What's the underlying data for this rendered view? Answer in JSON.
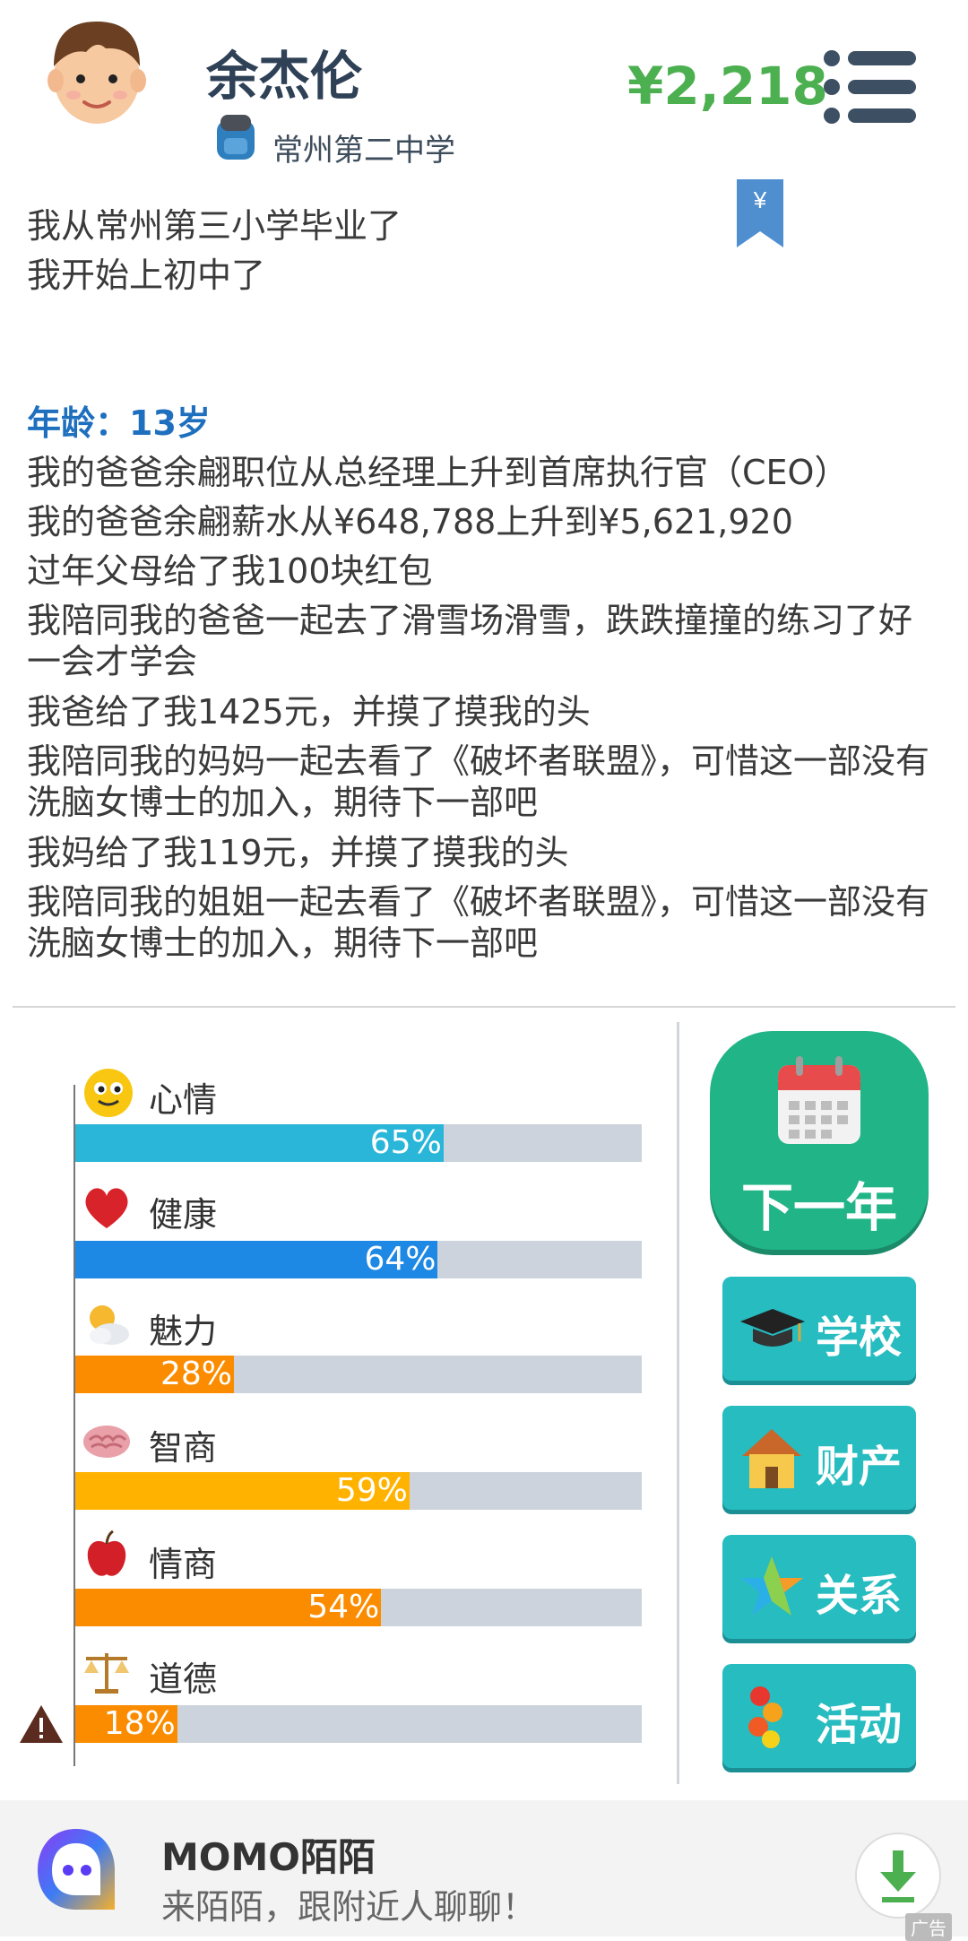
{
  "header": {
    "name": "余杰伦",
    "school": "常州第二中学",
    "money": "¥2,218",
    "avatar_icon": "boy-avatar-icon",
    "school_icon": "backpack-icon",
    "menu_icon": "menu-icon"
  },
  "log": {
    "lines_before": [
      "我从常州第三小学毕业了",
      "我开始上初中了"
    ],
    "age_label": "年龄：13岁",
    "lines_after": [
      "我的爸爸余翩职位从总经理上升到首席执行官（CEO）",
      "我的爸爸余翩薪水从¥648,788上升到¥5,621,920",
      "过年父母给了我100块红包",
      "我陪同我的爸爸一起去了滑雪场滑雪，跌跌撞撞的练习了好一会才学会",
      "我爸给了我1425元，并摸了摸我的头",
      "我陪同我的妈妈一起去看了《破坏者联盟》，可惜这一部没有洗脑女博士的加入，期待下一部吧",
      "我妈给了我119元，并摸了摸我的头",
      "我陪同我的姐姐一起去看了《破坏者联盟》，可惜这一部没有洗脑女博士的加入，期待下一部吧"
    ]
  },
  "stats": [
    {
      "label": "心情",
      "value": 65,
      "text": "65%",
      "color": "#29b6d8",
      "icon": "smiley-icon"
    },
    {
      "label": "健康",
      "value": 64,
      "text": "64%",
      "color": "#1e88e5",
      "icon": "heart-icon"
    },
    {
      "label": "魅力",
      "value": 28,
      "text": "28%",
      "color": "#fb8c00",
      "icon": "sun-cloud-icon"
    },
    {
      "label": "智商",
      "value": 59,
      "text": "59%",
      "color": "#ffb300",
      "icon": "brain-icon"
    },
    {
      "label": "情商",
      "value": 54,
      "text": "54%",
      "color": "#fb8c00",
      "icon": "apple-icon"
    },
    {
      "label": "道德",
      "value": 18,
      "text": "18%",
      "color": "#fb8c00",
      "icon": "scales-icon"
    }
  ],
  "buttons": {
    "next_year": "下一年",
    "school": "学校",
    "property": "财产",
    "relations": "关系",
    "activities": "活动"
  },
  "ad": {
    "title": "MOMO陌陌",
    "subtitle": "来陌陌，跟附近人聊聊！",
    "tag": "广告"
  },
  "colors": {
    "money": "#4caf50",
    "age": "#1f6fbf",
    "next_year_btn": "#20b486",
    "side_btn": "#26bcc0"
  }
}
